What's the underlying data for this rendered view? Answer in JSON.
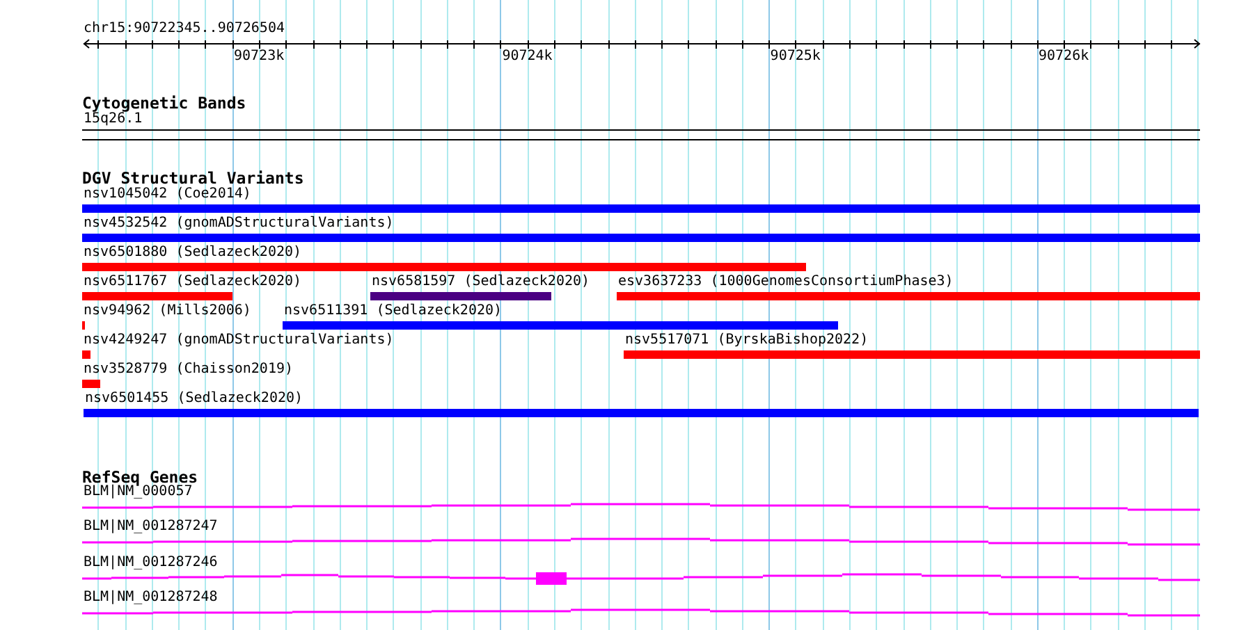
{
  "ruler": {
    "location": "chr15:90722345..90726504",
    "ticks": [
      "90723k",
      "90724k",
      "90725k",
      "90726k"
    ]
  },
  "tracks": [
    {
      "kind": "cytoband",
      "title": "Cytogenetic Bands",
      "features": [
        {
          "label": "15q26.1"
        }
      ]
    },
    {
      "kind": "variants",
      "title": "DGV Structural Variants",
      "features": [
        {
          "label": "nsv1045042 (Coe2014)",
          "color": "#0000ff"
        },
        {
          "label": "nsv4532542 (gnomADStructuralVariants)",
          "color": "#0000ff"
        },
        {
          "label": "nsv6501880 (Sedlazeck2020)",
          "color": "#ff0000"
        },
        {
          "label": "nsv6511767 (Sedlazeck2020)",
          "color": "#ff0000"
        },
        {
          "label": "nsv6581597 (Sedlazeck2020)",
          "color": "#4b0082"
        },
        {
          "label": "esv3637233 (1000GenomesConsortiumPhase3)",
          "color": "#ff0000"
        },
        {
          "label": "nsv94962 (Mills2006)",
          "color": "#ff0000"
        },
        {
          "label": "nsv6511391 (Sedlazeck2020)",
          "color": "#0000ff"
        },
        {
          "label": "nsv4249247 (gnomADStructuralVariants)",
          "color": "#ff0000"
        },
        {
          "label": "nsv5517071 (ByrskaBishop2022)",
          "color": "#ff0000"
        },
        {
          "label": "nsv3528779 (Chaisson2019)",
          "color": "#ff0000"
        },
        {
          "label": "nsv6501455 (Sedlazeck2020)",
          "color": "#0000ff"
        }
      ]
    },
    {
      "kind": "genes",
      "title": "RefSeq Genes",
      "features": [
        {
          "label": "BLM|NM_000057"
        },
        {
          "label": "BLM|NM_001287247"
        },
        {
          "label": "BLM|NM_001287246"
        },
        {
          "label": "BLM|NM_001287248"
        }
      ]
    }
  ]
}
